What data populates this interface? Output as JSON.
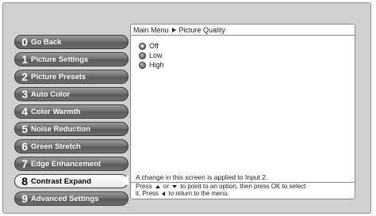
{
  "menu": {
    "items": [
      {
        "num": "0",
        "label": "Go Back"
      },
      {
        "num": "1",
        "label": "Picture Settings"
      },
      {
        "num": "2",
        "label": "Picture Presets"
      },
      {
        "num": "3",
        "label": "Auto Color"
      },
      {
        "num": "4",
        "label": "Color Warmth"
      },
      {
        "num": "5",
        "label": "Noise Reduction"
      },
      {
        "num": "6",
        "label": "Green Stretch"
      },
      {
        "num": "7",
        "label": "Edge Enhancement"
      },
      {
        "num": "8",
        "label": "Contrast Expand",
        "active": true
      },
      {
        "num": "9",
        "label": "Advanced Settings"
      }
    ]
  },
  "panel": {
    "breadcrumb": {
      "parent": "Main Menu",
      "current": "Picture Quality"
    },
    "options": [
      {
        "label": "Off",
        "selected": true
      },
      {
        "label": "Low",
        "selected": false
      },
      {
        "label": "High",
        "selected": false
      }
    ],
    "notice": "A change in this screen is applied to Input 2.",
    "help": {
      "part1": "Press",
      "part2": "or",
      "part3": "to point to an option, then press OK to select",
      "part4": "it. Press",
      "part5": "to return to the menu."
    }
  },
  "colors": {
    "background": "#d0d0d0",
    "button": "#6f6f6f",
    "active_button": "#ffffff"
  },
  "icons": [
    "breadcrumb-arrow-icon",
    "up-arrow-icon",
    "down-arrow-icon",
    "left-arrow-icon",
    "radio-icon"
  ]
}
